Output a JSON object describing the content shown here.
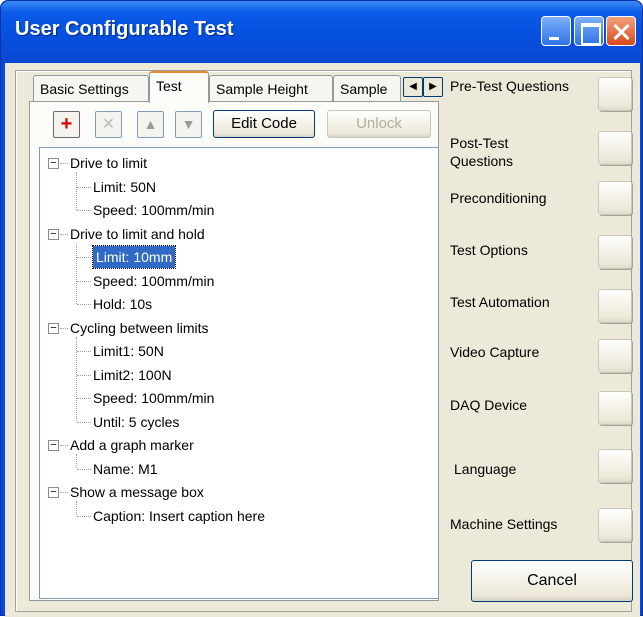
{
  "window": {
    "title": "User Configurable Test"
  },
  "tabs": [
    {
      "label": "Basic Settings"
    },
    {
      "label": "Test"
    },
    {
      "label": "Sample Height"
    },
    {
      "label": "Sample"
    }
  ],
  "toolbar": {
    "add_icon": "+",
    "delete_icon": "×",
    "up_icon": "▲",
    "down_icon": "▼",
    "edit_code_label": "Edit Code",
    "unlock_label": "Unlock"
  },
  "tree": {
    "nodes": [
      {
        "label": "Drive to limit",
        "children": [
          "Limit: 50N",
          "Speed: 100mm/min"
        ]
      },
      {
        "label": "Drive to limit and hold",
        "children": [
          "Limit: 10mm",
          "Speed: 100mm/min",
          "Hold: 10s"
        ]
      },
      {
        "label": "Cycling between limits",
        "children": [
          "Limit1: 50N",
          "Limit2: 100N",
          "Speed: 100mm/min",
          "Until: 5 cycles"
        ]
      },
      {
        "label": "Add a graph marker",
        "children": [
          "Name: M1"
        ]
      },
      {
        "label": "Show a message box",
        "children": [
          "Caption: Insert caption here"
        ]
      }
    ],
    "selected": "Limit: 10mm"
  },
  "side": {
    "pre_test": "Pre-Test Questions",
    "post_test": "Post-Test Questions",
    "preconditioning": "Preconditioning",
    "test_options": "Test Options",
    "test_automation": "Test Automation",
    "video_capture": "Video Capture",
    "daq_device": "DAQ Device",
    "language": "Language",
    "machine_settings": "Machine Settings"
  },
  "footer": {
    "cancel_label": "Cancel"
  },
  "colors": {
    "titlebar": "#0a56e0",
    "selection": "#316ac5",
    "active_tab_accent": "#e68b2c",
    "add_icon": "#d00000"
  }
}
